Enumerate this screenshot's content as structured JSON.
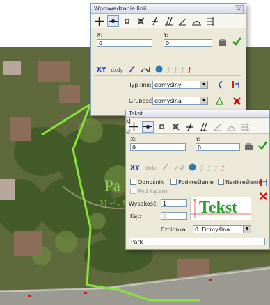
{
  "window1": {
    "title": "Wprowadzanie linii",
    "close_glyph": "×",
    "x_label": "X:",
    "x_value": "0",
    "y_label": "Y:",
    "y_value": "0",
    "xy_button": "XY",
    "dxdy_button": "dxdy",
    "line_type_label": "Typ linii:",
    "line_type_value": "domyślny",
    "thickness_label": "Grubość:",
    "thickness_value": "domyślna"
  },
  "window2": {
    "tab_label": "Tekst",
    "m_label": "M",
    "d_label": "D",
    "x_label": "X:",
    "x_value": "0",
    "y_label": "Y:",
    "y_value": "0",
    "xy_button": "XY",
    "dxdy_button": "dxdy",
    "odnosnik_label": "Odnośnik",
    "podkreslenie_label": "Podkreślenie",
    "nadkreslenie_label": "Nadkreślenie",
    "pod_katem_label": "Pod kątem",
    "wysokosc_label": "Wysokość:",
    "wysokosc_value": "1",
    "kat_label": "Kąt:",
    "kat_value": "0",
    "preview_text": "Tekst",
    "czcionka_label": "Czcionka :",
    "czcionka_value": "0. Domyślna",
    "text_value": "Park"
  },
  "map": {
    "park_label": "Pa",
    "parcel_label": "3] -4, 9"
  },
  "colors": {
    "boundary_green": "#88e43a",
    "text_green": "#2aa12a",
    "confirm_green": "#1f9a1f",
    "cancel_red": "#cc1111",
    "window_face": "#ece9d8"
  }
}
